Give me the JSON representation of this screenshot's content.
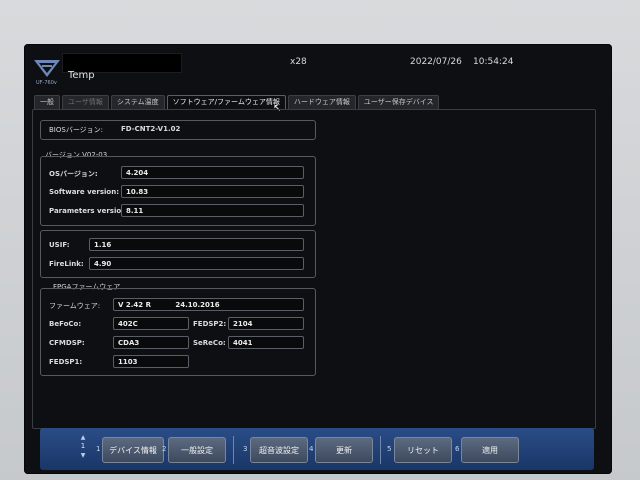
{
  "header": {
    "logo_text": "UF-760v",
    "app_title": "Temp",
    "zoom": "x28",
    "date": "2022/07/26",
    "time": "10:54:24"
  },
  "tabs": [
    {
      "label": "一般"
    },
    {
      "label": "ユーザ情報"
    },
    {
      "label": "システム温度"
    },
    {
      "label": "ソフトウェア/ファームウェア情報"
    },
    {
      "label": "ハードウェア情報"
    },
    {
      "label": "ユーザー保存デバイス"
    }
  ],
  "bios": {
    "label": "BIOSバージョン:",
    "value": "FD-CNT2-V1.02"
  },
  "version": {
    "title": "バージョン V02-03",
    "os_label": "OSバージョン:",
    "os_value": "4.204",
    "software_label": "Software version:",
    "software_value": "10.83",
    "parameters_label": "Parameters version:",
    "parameters_value": "8.11"
  },
  "usif": {
    "usif_label": "USIF:",
    "usif_value": "1.16",
    "firelink_label": "FireLink:",
    "firelink_value": "4.90"
  },
  "fpga": {
    "title": "FPGAファームウェア",
    "firmware_label": "ファームウェア:",
    "firmware_value": "V 2.42 R          24.10.2016",
    "befoco_label": "BeFoCo:",
    "befoco_value": "402C",
    "fedsp2_label": "FEDSP2:",
    "fedsp2_value": "2104",
    "cfmdsp_label": "CFMDSP:",
    "cfmdsp_value": "CDA3",
    "sereco_label": "SeReCo:",
    "sereco_value": "4041",
    "fedsp1_label": "FEDSP1:",
    "fedsp1_value": "1103"
  },
  "bottom": {
    "page_number": "1",
    "buttons": [
      {
        "num": "1",
        "label": "デバイス情報"
      },
      {
        "num": "2",
        "label": "一般設定"
      },
      {
        "num": "3",
        "label": "超音波設定"
      },
      {
        "num": "4",
        "label": "更新"
      },
      {
        "num": "5",
        "label": "リセット"
      },
      {
        "num": "6",
        "label": "適用"
      }
    ]
  },
  "colors": {
    "screen_bg": "#0d0f12",
    "bottom_bar": "#1f3f74",
    "logo": "#6f87b8"
  }
}
